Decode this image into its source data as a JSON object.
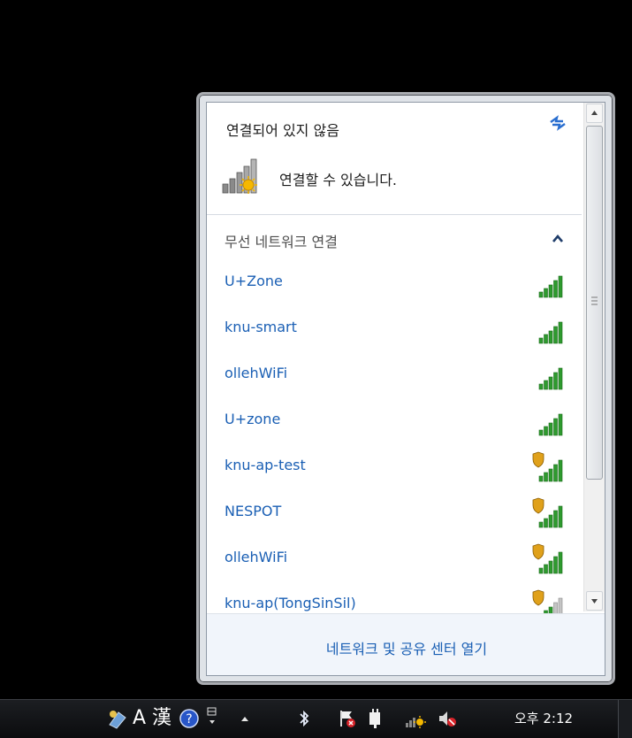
{
  "popup": {
    "status_title": "연결되어 있지 않음",
    "connection_text": "연결할 수 있습니다.",
    "section_label": "무선 네트워크 연결",
    "networks": [
      {
        "name": "U+Zone",
        "secured": false,
        "strength": 5
      },
      {
        "name": "knu-smart",
        "secured": false,
        "strength": 5
      },
      {
        "name": "ollehWiFi",
        "secured": false,
        "strength": 5
      },
      {
        "name": "U+zone",
        "secured": false,
        "strength": 5
      },
      {
        "name": "knu-ap-test",
        "secured": true,
        "strength": 5
      },
      {
        "name": "NESPOT",
        "secured": true,
        "strength": 5
      },
      {
        "name": "ollehWiFi",
        "secured": true,
        "strength": 5
      },
      {
        "name": "knu-ap(TongSinSil)",
        "secured": true,
        "strength": 3
      }
    ],
    "footer_link": "네트워크 및 공유 센터 열기"
  },
  "taskbar": {
    "ime_mode": "A",
    "hanja": "漢",
    "clock": "오후 2:12"
  },
  "colors": {
    "link": "#1a5fb4",
    "signal": "#2e9a2e",
    "shield": "#e0a11b"
  }
}
